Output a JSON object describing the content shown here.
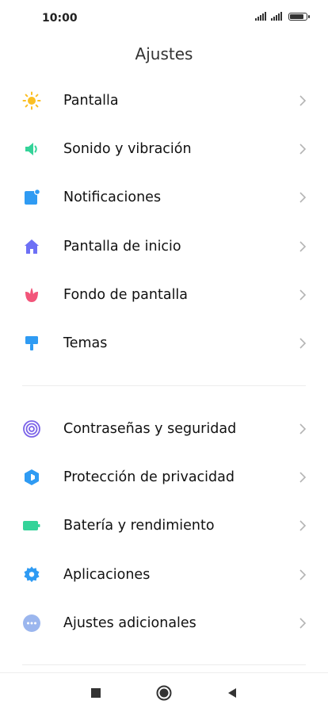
{
  "status_bar": {
    "time": "10:00",
    "battery_level": 0.85
  },
  "header": {
    "title": "Ajustes"
  },
  "colors": {
    "display": "#FBBF24",
    "sound": "#34D399",
    "notifications": "#2F9BF3",
    "home": "#6D70F5",
    "wallpaper": "#F2557A",
    "themes": "#2F9BF3",
    "passwords": "#7B63E8",
    "privacy": "#2F9BF3",
    "battery": "#34D399",
    "apps": "#2F9BF3",
    "additional": "#9BB6EE"
  },
  "groups": [
    {
      "items": [
        {
          "label": "Pantalla",
          "icon": "sun-icon"
        },
        {
          "label": "Sonido y vibración",
          "icon": "speaker-icon"
        },
        {
          "label": "Notificaciones",
          "icon": "notification-icon"
        },
        {
          "label": "Pantalla de inicio",
          "icon": "home-icon"
        },
        {
          "label": "Fondo de pantalla",
          "icon": "tulip-icon"
        },
        {
          "label": "Temas",
          "icon": "paint-brush-icon"
        }
      ]
    },
    {
      "items": [
        {
          "label": "Contraseñas y seguridad",
          "icon": "fingerprint-icon"
        },
        {
          "label": "Protección de privacidad",
          "icon": "shield-icon"
        },
        {
          "label": "Batería y rendimiento",
          "icon": "battery-icon"
        },
        {
          "label": "Aplicaciones",
          "icon": "gear-icon"
        },
        {
          "label": "Ajustes adicionales",
          "icon": "more-icon"
        }
      ]
    }
  ],
  "nav_bar": {
    "recent": "square-icon",
    "home": "circle-icon",
    "back": "back-triangle-icon"
  }
}
